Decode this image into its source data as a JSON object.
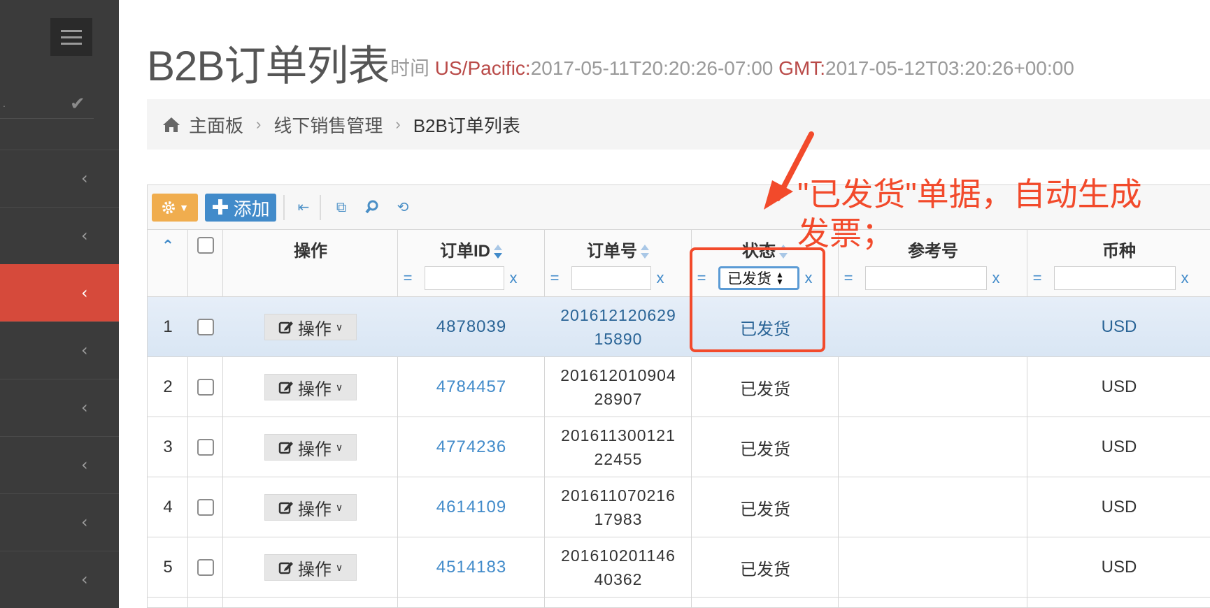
{
  "sidebar": {
    "check_dot": ".",
    "check_glyph": "✔",
    "items": [
      {
        "chevron": "‹",
        "active": false
      },
      {
        "chevron": "‹",
        "active": false
      },
      {
        "chevron": "‹",
        "active": true
      },
      {
        "chevron": "‹",
        "active": false
      },
      {
        "chevron": "‹",
        "active": false
      },
      {
        "chevron": "‹",
        "active": false
      },
      {
        "chevron": "‹",
        "active": false
      },
      {
        "chevron": "‹",
        "active": false
      }
    ]
  },
  "header": {
    "title": "B2B订单列表",
    "meta_prefix": "时间 ",
    "tz1_label": "US/Pacific:",
    "tz1_value": "2017-05-11T20:20:26-07:00 ",
    "tz2_label": "GMT:",
    "tz2_value": "2017-05-12T03:20:26+00:00"
  },
  "breadcrumb": {
    "items": [
      "主面板",
      "线下销售管理",
      "B2B订单列表"
    ],
    "separator": "›"
  },
  "toolbar": {
    "add_label": "添加",
    "add_plus": "✚"
  },
  "table": {
    "headers": {
      "collapse": "⌃",
      "action": "操作",
      "order_id": "订单ID",
      "order_no": "订单号",
      "status": "状态",
      "ref_no": "参考号",
      "currency": "币种"
    },
    "filters": {
      "eq": "=",
      "clear": "x",
      "status_selected": "已发货"
    },
    "action_label": "操作",
    "rows": [
      {
        "num": "1",
        "order_id": "4878039",
        "order_no_1": "201612120629",
        "order_no_2": "15890",
        "status": "已发货",
        "ref_no": "",
        "currency": "USD"
      },
      {
        "num": "2",
        "order_id": "4784457",
        "order_no_1": "201612010904",
        "order_no_2": "28907",
        "status": "已发货",
        "ref_no": "",
        "currency": "USD"
      },
      {
        "num": "3",
        "order_id": "4774236",
        "order_no_1": "201611300121",
        "order_no_2": "22455",
        "status": "已发货",
        "ref_no": "",
        "currency": "USD"
      },
      {
        "num": "4",
        "order_id": "4614109",
        "order_no_1": "201611070216",
        "order_no_2": "17983",
        "status": "已发货",
        "ref_no": "",
        "currency": "USD"
      },
      {
        "num": "5",
        "order_id": "4514183",
        "order_no_1": "201610201146",
        "order_no_2": "40362",
        "status": "已发货",
        "ref_no": "",
        "currency": "USD"
      }
    ]
  },
  "annotation": {
    "line1": "\"已发货\"单据，自动生成",
    "line2": "发票；",
    "color": "#f24a2b"
  },
  "colors": {
    "sidebar_bg": "#3b3b3b",
    "sidebar_active": "#d64a3b",
    "gear_button": "#f0ad4e",
    "add_button": "#428bca",
    "link": "#428bca"
  }
}
